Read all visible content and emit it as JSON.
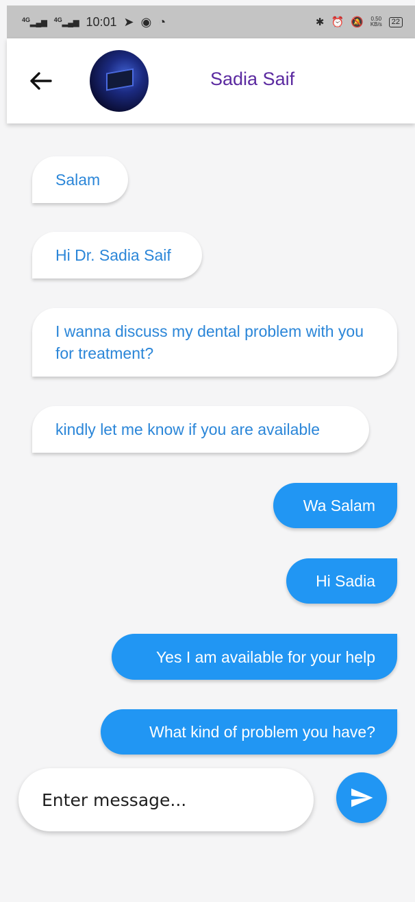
{
  "status_bar": {
    "network1": "4G",
    "network2": "4G",
    "time": "10:01",
    "speed_value": "0.50",
    "speed_unit": "KB/s",
    "battery": "22"
  },
  "header": {
    "contact_name": "Sadia Saif"
  },
  "messages": [
    {
      "text": "Salam",
      "direction": "received"
    },
    {
      "text": "Hi Dr. Sadia Saif",
      "direction": "received"
    },
    {
      "text": "I wanna discuss my dental problem with you for treatment?",
      "direction": "received"
    },
    {
      "text": "kindly let me know if you are available",
      "direction": "received"
    },
    {
      "text": "Wa Salam",
      "direction": "sent"
    },
    {
      "text": "Hi Sadia",
      "direction": "sent"
    },
    {
      "text": "Yes I am available for your help",
      "direction": "sent"
    },
    {
      "text": "What kind of problem you have?",
      "direction": "sent"
    }
  ],
  "composer": {
    "placeholder": "Enter message..."
  },
  "colors": {
    "accent": "#2196f3",
    "received_text": "#2b86d8",
    "contact_name": "#5b2aa0",
    "background": "#f5f5f6"
  },
  "icons": {
    "back": "arrow-left-icon",
    "send": "send-icon"
  }
}
